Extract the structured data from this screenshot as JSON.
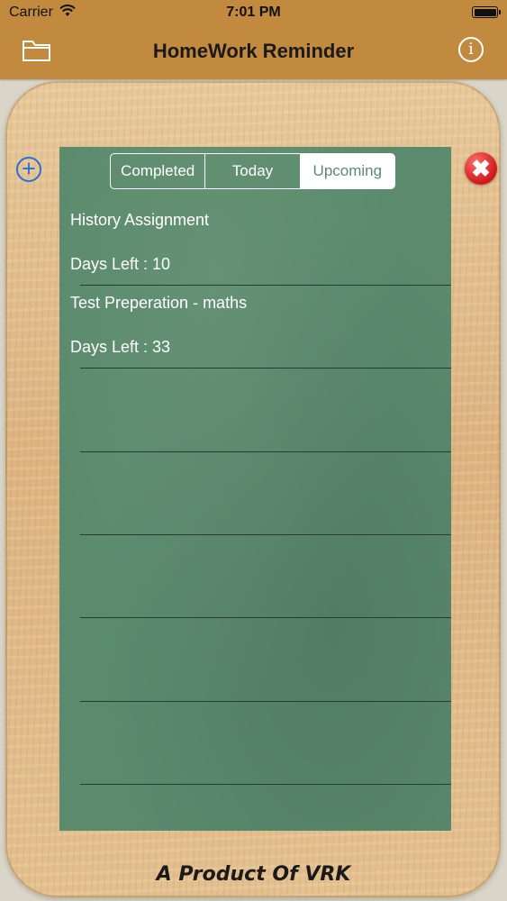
{
  "status_bar": {
    "carrier": "Carrier",
    "time": "7:01 PM"
  },
  "nav": {
    "title": "HomeWork Reminder",
    "left_icon": "folder-icon",
    "right_icon": "info-icon",
    "info_glyph": "i"
  },
  "tabs": [
    {
      "label": "Completed",
      "active": false
    },
    {
      "label": "Today",
      "active": false
    },
    {
      "label": "Upcoming",
      "active": true
    }
  ],
  "actions": {
    "add_icon": "plus-circle-icon",
    "add_glyph": "+",
    "delete_icon": "close-circle-icon",
    "delete_glyph": "✖"
  },
  "tasks": [
    {
      "title": "History Assignment",
      "days_left": "Days Left : 10"
    },
    {
      "title": "Test Preperation - maths",
      "days_left": "Days Left : 33"
    }
  ],
  "footer": "A Product Of VRK",
  "colors": {
    "top_bar": "#c18a3f",
    "board": "#5b8a6d",
    "add_button": "#2b6fd6",
    "delete_button": "#d01818"
  }
}
